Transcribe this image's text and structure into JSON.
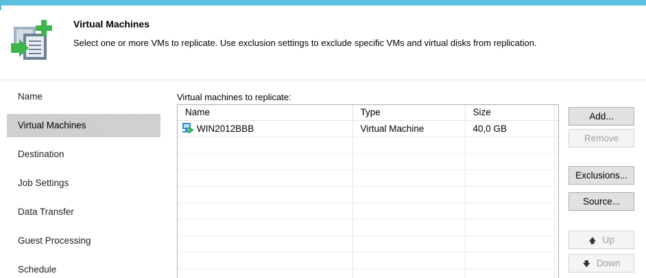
{
  "header": {
    "title": "Virtual Machines",
    "description": "Select one or more VMs to replicate. Use exclusion settings to exclude specific VMs and virtual disks from replication."
  },
  "nav": {
    "items": [
      {
        "label": "Name"
      },
      {
        "label": "Virtual Machines",
        "active": true
      },
      {
        "label": "Destination"
      },
      {
        "label": "Job Settings"
      },
      {
        "label": "Data Transfer"
      },
      {
        "label": "Guest Processing"
      },
      {
        "label": "Schedule"
      }
    ]
  },
  "content": {
    "list_label": "Virtual machines to replicate:",
    "columns": [
      "Name",
      "Type",
      "Size"
    ],
    "rows": [
      {
        "name": "WIN2012BBB",
        "type": "Virtual Machine",
        "size": "40,0 GB",
        "icon": "vm-icon"
      }
    ]
  },
  "buttons": {
    "add": "Add...",
    "remove": "Remove",
    "exclusions": "Exclusions...",
    "source": "Source...",
    "up": "Up",
    "down": "Down"
  },
  "colors": {
    "accent": "#5bc0de",
    "icon_green": "#3cb54a",
    "selected_nav": "#c9c9c9"
  }
}
